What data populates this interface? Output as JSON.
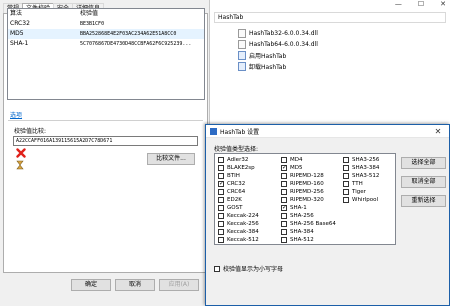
{
  "props": {
    "tabs": [
      "常规",
      "文件校验",
      "安全",
      "详细信息"
    ],
    "active_tab": 1,
    "list_headers": [
      "算法",
      "校验值"
    ],
    "hashes": [
      {
        "name": "CRC32",
        "value": "BE3B1CF0"
      },
      {
        "name": "MD5",
        "value": "BBA252868E4E2F03AC234A62E51A8CC0"
      },
      {
        "name": "SHA-1",
        "value": "5C7076867DE4730D48CCBFA62F6C925239..."
      }
    ],
    "settings_link": "选项",
    "compare_label": "校验值比较:",
    "compare_value": "A22CCAFF016A139115615A2D7C78D671",
    "compare_file_button": "比较文件...",
    "ok_button": "确定",
    "cancel_button": "取消",
    "apply_button": "应用(A)"
  },
  "explorer": {
    "address": "HashTab",
    "files": [
      {
        "name": "HashTab32-6.0.0.34.dll",
        "icon": "dll-file-icon"
      },
      {
        "name": "HashTab64-6.0.0.34.dll",
        "icon": "dll-file-icon"
      },
      {
        "name": "启用HashTab",
        "icon": "exe-file-icon"
      },
      {
        "name": "卸载HashTab",
        "icon": "exe-file-icon"
      }
    ]
  },
  "dialog": {
    "title": "HashTab 设置",
    "group_label": "校验值类型选择:",
    "columns": [
      [
        {
          "name": "Adler32",
          "checked": false
        },
        {
          "name": "BLAKE2sp",
          "checked": false
        },
        {
          "name": "BTIH",
          "checked": false
        },
        {
          "name": "CRC32",
          "checked": true
        },
        {
          "name": "CRC64",
          "checked": false
        },
        {
          "name": "ED2K",
          "checked": false
        },
        {
          "name": "GOST",
          "checked": false
        },
        {
          "name": "Keccak-224",
          "checked": false
        },
        {
          "name": "Keccak-256",
          "checked": false
        },
        {
          "name": "Keccak-384",
          "checked": false
        },
        {
          "name": "Keccak-512",
          "checked": false
        },
        {
          "name": "MD2",
          "checked": false
        }
      ],
      [
        {
          "name": "MD4",
          "checked": false
        },
        {
          "name": "MD5",
          "checked": true
        },
        {
          "name": "RIPEMD-128",
          "checked": false
        },
        {
          "name": "RIPEMD-160",
          "checked": false
        },
        {
          "name": "RIPEMD-256",
          "checked": false
        },
        {
          "name": "RIPEMD-320",
          "checked": false
        },
        {
          "name": "SHA-1",
          "checked": true
        },
        {
          "name": "SHA-256",
          "checked": false
        },
        {
          "name": "SHA-256 Base64",
          "checked": false
        },
        {
          "name": "SHA-384",
          "checked": false
        },
        {
          "name": "SHA-512",
          "checked": false
        },
        {
          "name": "SHA3-224",
          "checked": false
        }
      ],
      [
        {
          "name": "SHA3-256",
          "checked": false
        },
        {
          "name": "SHA3-384",
          "checked": false
        },
        {
          "name": "SHA3-512",
          "checked": false
        },
        {
          "name": "TTH",
          "checked": false
        },
        {
          "name": "Tiger",
          "checked": false
        },
        {
          "name": "Whirlpool",
          "checked": false
        }
      ]
    ],
    "select_all_button": "选择全部",
    "deselect_all_button": "取消全部",
    "reset_button": "重新选择",
    "lowercase_option": "校验值显示为小写字母",
    "lowercase_checked": false
  }
}
